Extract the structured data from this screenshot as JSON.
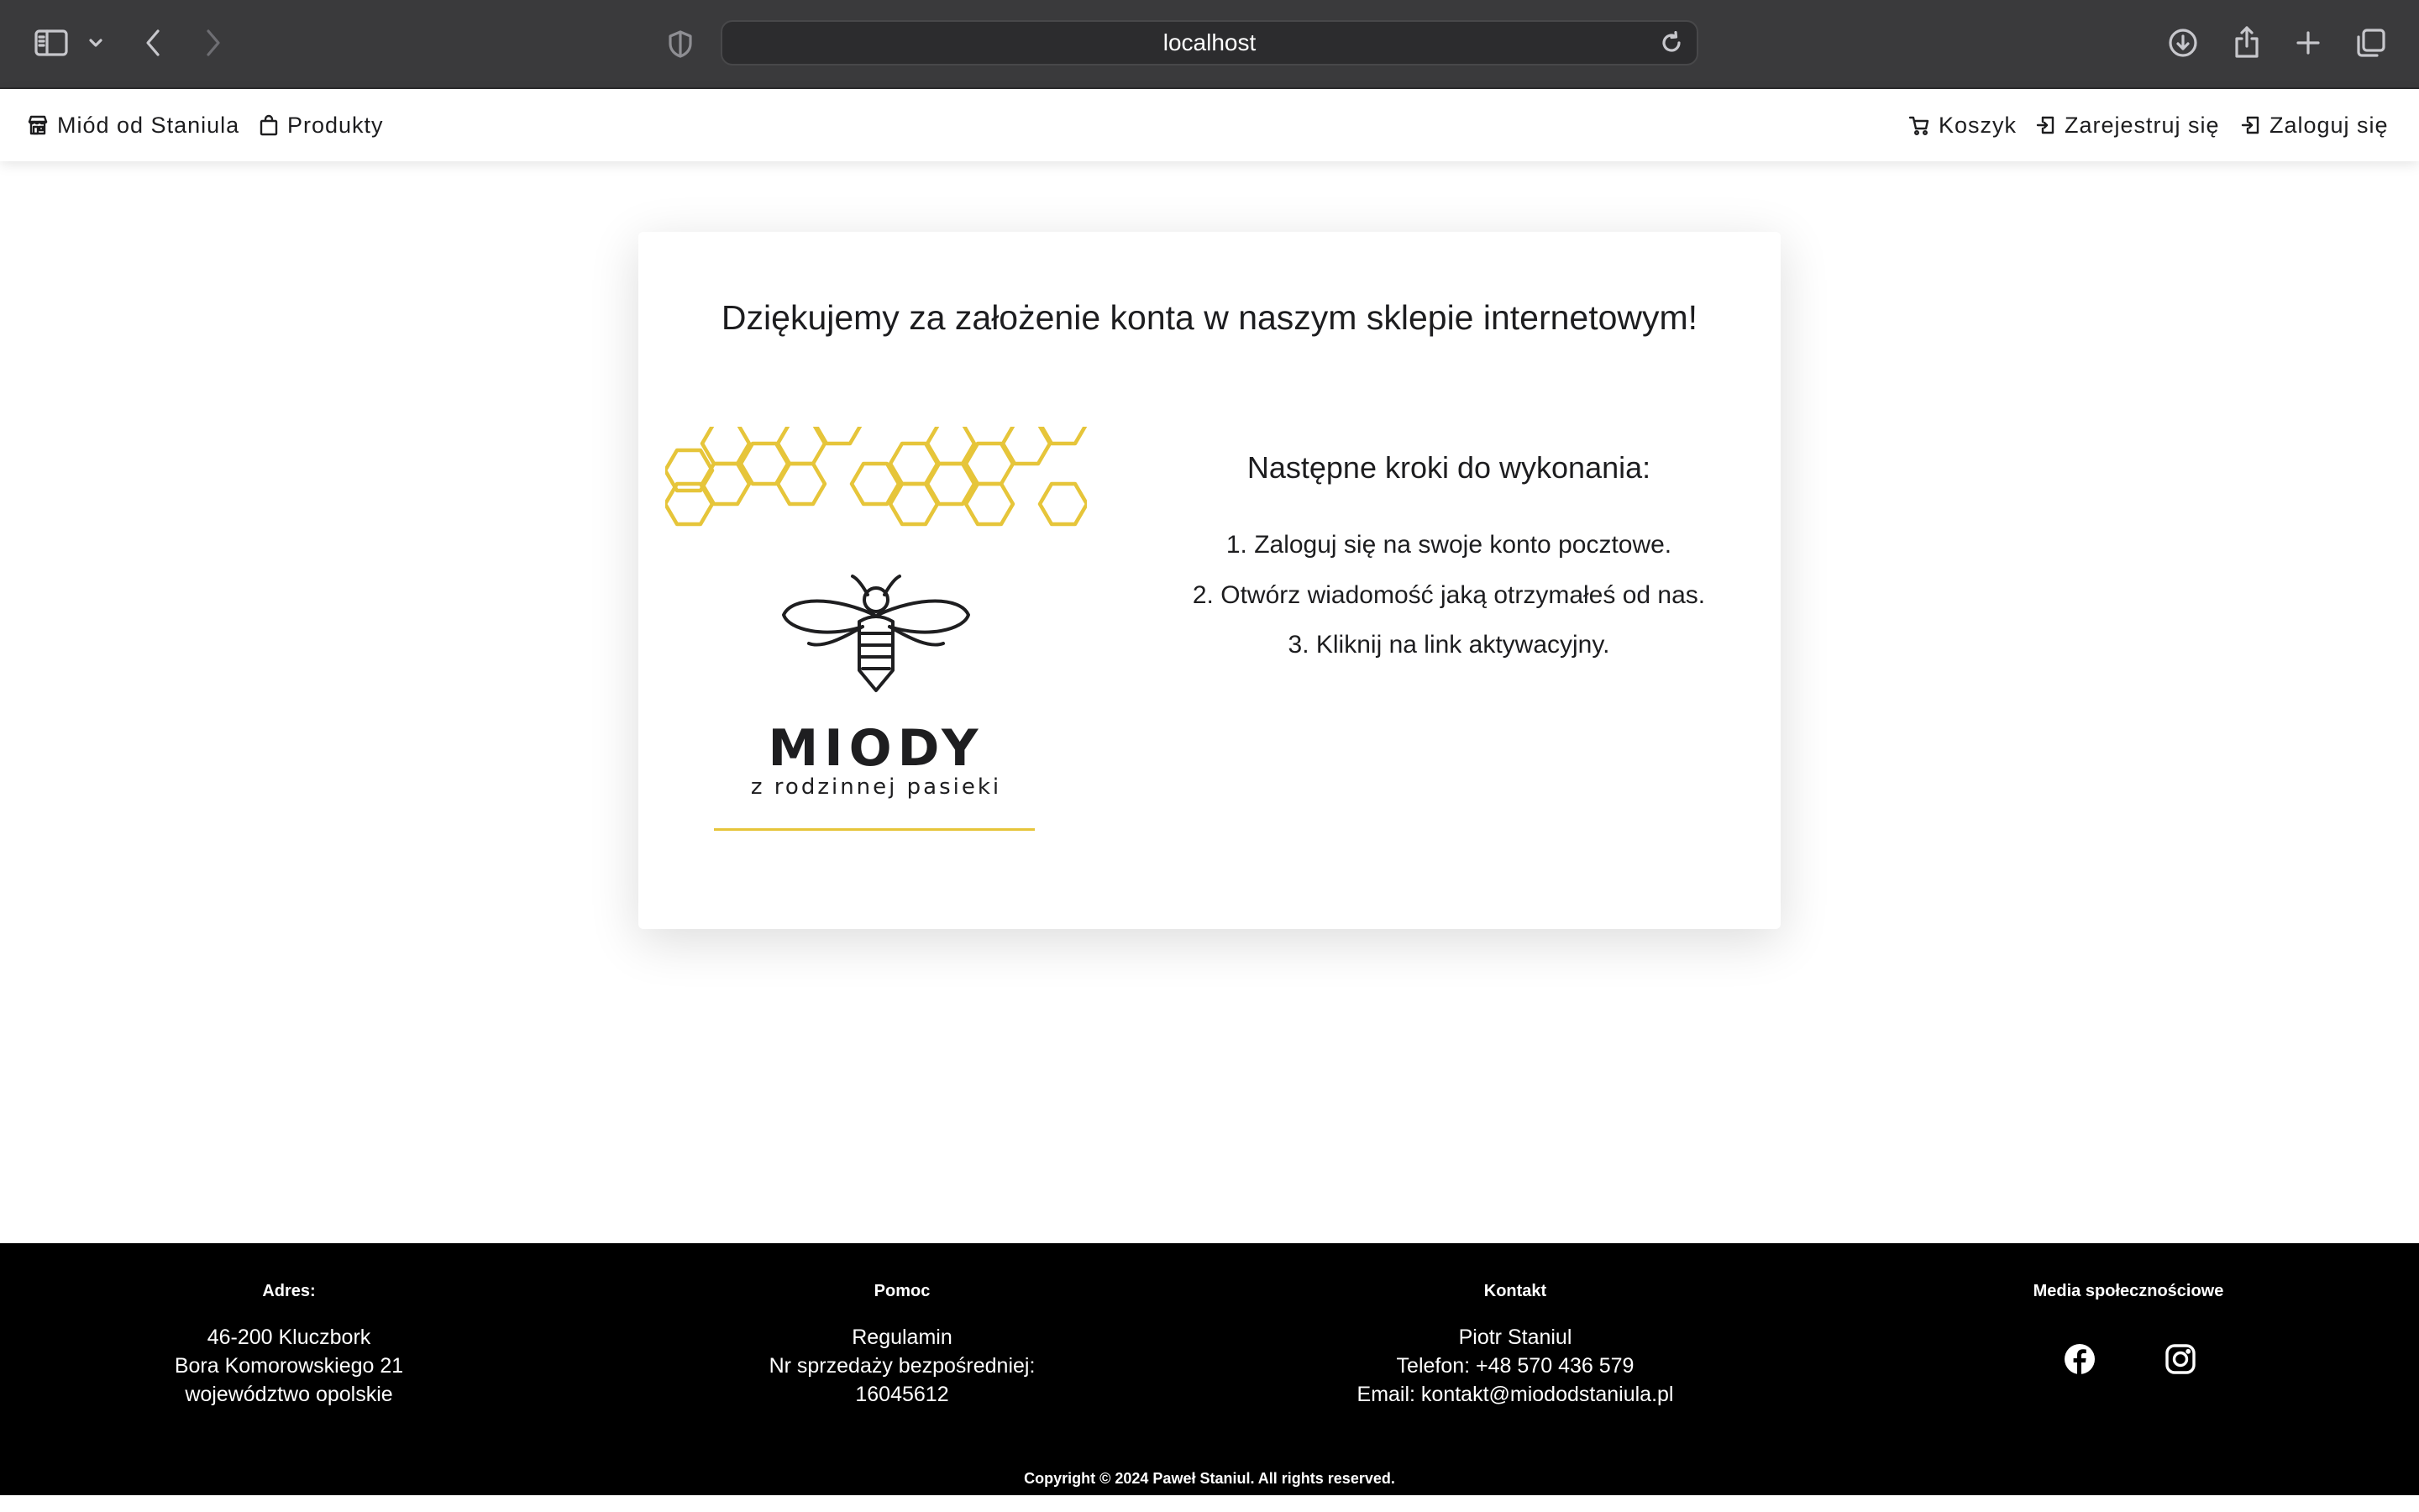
{
  "browser": {
    "url": "localhost",
    "icons": [
      "sidebar-icon",
      "chevron-down-icon",
      "back-icon",
      "forward-icon",
      "shield-icon",
      "reload-icon",
      "download-icon",
      "share-icon",
      "new-tab-icon",
      "tabs-overview-icon"
    ]
  },
  "nav": {
    "brand": "Miód od Staniula",
    "products": "Produkty",
    "cart": "Koszyk",
    "register": "Zarejestruj się",
    "login": "Zaloguj się"
  },
  "card": {
    "title": "Dziękujemy za założenie konta w naszym sklepie internetowym!",
    "logo": {
      "word": "MIODY",
      "tagline": "z rodzinnej pasieki",
      "accent_color": "#e6c53a"
    },
    "steps_title": "Następne kroki do wykonania:",
    "steps": [
      "1.  Zaloguj się na swoje konto pocztowe.",
      "2.  Otwórz wiadomość jaką otrzymałeś od nas.",
      "3.  Kliknij na link aktywacyjny."
    ]
  },
  "footer": {
    "address": {
      "heading": "Adres:",
      "lines": [
        "46-200 Kluczbork",
        "Bora Komorowskiego 21",
        "województwo opolskie"
      ]
    },
    "help": {
      "heading": "Pomoc",
      "lines": [
        "Regulamin",
        "Nr sprzedaży bezpośredniej:",
        "16045612"
      ]
    },
    "contact": {
      "heading": "Kontakt",
      "lines": [
        "Piotr Staniul",
        "Telefon: +48 570 436 579",
        "Email: kontakt@miododstaniula.pl"
      ]
    },
    "social": {
      "heading": "Media społecznościowe",
      "icons": [
        "facebook-icon",
        "instagram-icon"
      ]
    },
    "copyright": "Copyright © 2024 Paweł Staniul. All rights reserved."
  }
}
